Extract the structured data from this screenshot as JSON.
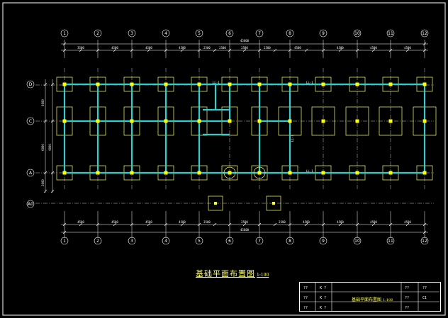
{
  "grid": {
    "top_labels": [
      "1",
      "2",
      "3",
      "4",
      "5",
      "6",
      "7",
      "8",
      "9",
      "10",
      "11",
      "12"
    ],
    "bottom_labels": [
      "1",
      "2",
      "3",
      "4",
      "5",
      "6",
      "7",
      "8",
      "9",
      "10",
      "11",
      "12"
    ],
    "row_labels": [
      "D",
      "C",
      "A",
      "A0"
    ]
  },
  "dimensions": {
    "top_overall": "45600",
    "top_segments": [
      "3500",
      "4500",
      "4500",
      "4500",
      "2500",
      "2500",
      "2500",
      "2500",
      "4500",
      "4500",
      "4500",
      "4500"
    ],
    "bottom_overall": "45600",
    "bottom_segments": [
      "4500",
      "4500",
      "4500",
      "4500",
      "3500",
      "2500",
      "2500",
      "4500",
      "4500",
      "4500",
      "4500"
    ],
    "left_upper": "6000",
    "left_mid": "6000",
    "left_lower": "3000",
    "left_total": "9000"
  },
  "beam_labels": [
    "LL-1",
    "LL-1",
    "LL-1",
    "LL-1"
  ],
  "drawing_title": {
    "text": "基础平面布置图",
    "scale": "1:100"
  },
  "title_block": {
    "title": "基础平面布置图",
    "scale": "1:100",
    "left_cells": [
      "??",
      "K ?",
      "??",
      "K ?",
      "??",
      "K ?"
    ],
    "right_cells": [
      "??",
      "??",
      "??",
      "C1",
      "??",
      ""
    ]
  },
  "colors": {
    "background": "#000000",
    "grid_line": "#ffffff",
    "foundation": "#ffff66",
    "beam": "#33cccc",
    "column": "#ffff00"
  }
}
